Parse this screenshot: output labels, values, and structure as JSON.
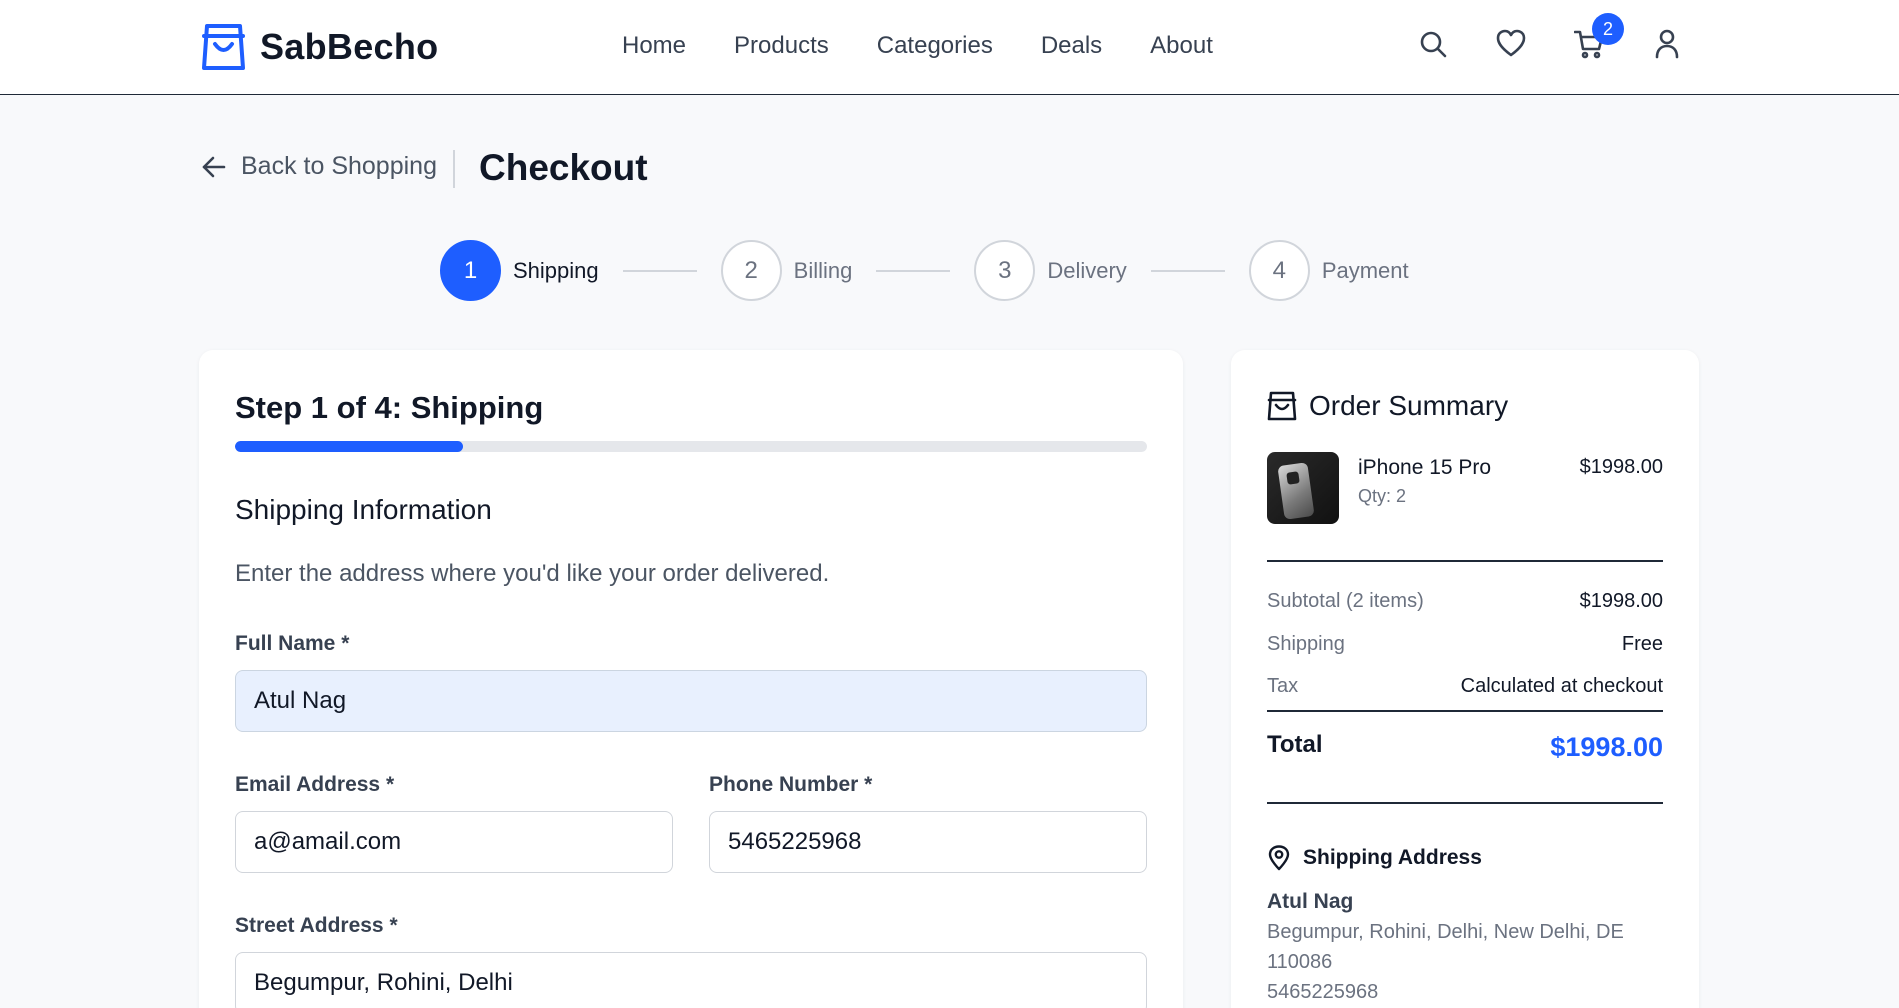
{
  "brand": {
    "name": "SabBecho",
    "logo_icon": "shopping-bag-icon",
    "accent": "#1e5eff"
  },
  "nav": [
    {
      "label": "Home"
    },
    {
      "label": "Products"
    },
    {
      "label": "Categories"
    },
    {
      "label": "Deals"
    },
    {
      "label": "About"
    }
  ],
  "header_icons": [
    "search-icon",
    "heart-icon",
    "cart-icon",
    "user-icon"
  ],
  "cart": {
    "count": "2"
  },
  "page": {
    "back_label": "Back to Shopping",
    "title": "Checkout"
  },
  "stepper": [
    {
      "number": "1",
      "label": "Shipping",
      "active": true
    },
    {
      "number": "2",
      "label": "Billing",
      "active": false
    },
    {
      "number": "3",
      "label": "Delivery",
      "active": false
    },
    {
      "number": "4",
      "label": "Payment",
      "active": false
    }
  ],
  "form": {
    "step_title": "Step 1 of 4: Shipping",
    "progress": 0.25,
    "section_title": "Shipping Information",
    "section_desc": "Enter the address where you'd like your order delivered.",
    "full_name": {
      "label": "Full Name *",
      "value": "Atul Nag"
    },
    "email": {
      "label": "Email Address *",
      "value": "a@amail.com"
    },
    "phone": {
      "label": "Phone Number *",
      "value": "5465225968"
    },
    "street": {
      "label": "Street Address *",
      "value": "Begumpur, Rohini, Delhi"
    }
  },
  "summary": {
    "title": "Order Summary",
    "item": {
      "name": "iPhone 15 Pro",
      "qty": "Qty: 2",
      "price": "$1998.00"
    },
    "subtotal": {
      "label": "Subtotal (2 items)",
      "value": "$1998.00"
    },
    "shipping": {
      "label": "Shipping",
      "value": "Free"
    },
    "tax": {
      "label": "Tax",
      "value": "Calculated at checkout"
    },
    "total": {
      "label": "Total",
      "value": "$1998.00"
    },
    "address": {
      "title": "Shipping Address",
      "name": "Atul Nag",
      "line1": "Begumpur, Rohini, Delhi, New Delhi, DE",
      "line2": "110086",
      "phone": "5465225968"
    }
  }
}
